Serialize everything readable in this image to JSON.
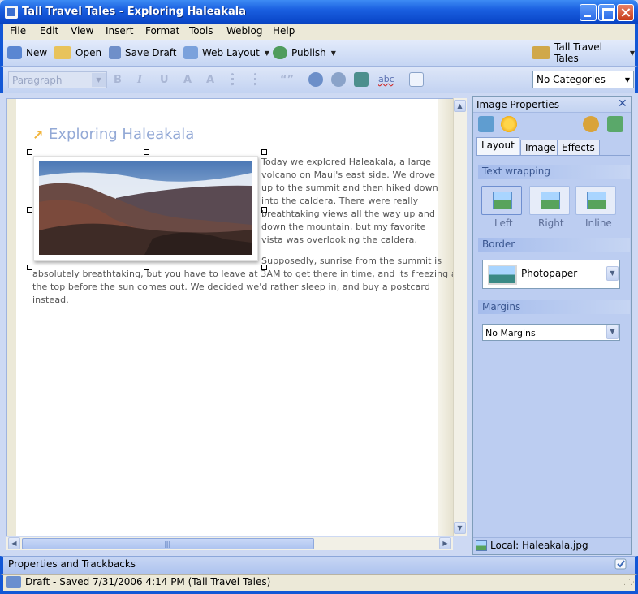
{
  "window": {
    "title": "Tall Travel Tales - Exploring Haleakala"
  },
  "menu": [
    "File",
    "Edit",
    "View",
    "Insert",
    "Format",
    "Tools",
    "Weblog",
    "Help"
  ],
  "toolbar": {
    "new_label": "New",
    "open_label": "Open",
    "save_draft_label": "Save Draft",
    "web_layout_label": "Web Layout",
    "publish_label": "Publish",
    "blog_label": "Tall Travel Tales"
  },
  "format_bar": {
    "style_value": "Paragraph",
    "bold": "B",
    "italic": "I",
    "underline": "U",
    "strike": "A",
    "color": "A",
    "quote": "“”",
    "spell": "abc",
    "category_value": "No Categories"
  },
  "editor": {
    "post_title": "Exploring Haleakala",
    "body_lines_beside_image": [
      "Today we explored Haleakala, a large",
      "volcano on Maui's east side.  We drove",
      "up to the summit and then hiked down",
      "into the caldera.  There were really",
      "breathtaking views all the way up and",
      "down the mountain, but my favorite",
      "vista was overlooking the caldera."
    ],
    "body_lines_full": [
      "Supposedly, sunrise from the summit is",
      "absolutely breathtaking, but you have to leave at 3AM to get there in time, and its freezing at",
      "the top before the sun comes out. We decided we'd rather sleep in, and buy a postcard",
      "instead."
    ]
  },
  "image_properties": {
    "title": "Image Properties",
    "tabs": [
      "Layout",
      "Image",
      "Effects"
    ],
    "active_tab": "Layout",
    "text_wrapping_label": "Text wrapping",
    "wrap_options": [
      "Left",
      "Right",
      "Inline"
    ],
    "selected_wrap": "Left",
    "border_label": "Border",
    "border_value": "Photopaper",
    "margins_label": "Margins",
    "margins_value": "No Margins",
    "local_file": "Local:  Haleakala.jpg"
  },
  "bottom": {
    "properties_label": "Properties and Trackbacks",
    "status_text": "Draft - Saved 7/31/2006 4:14 PM (Tall Travel Tales)"
  },
  "colors": {
    "title_bar": "#1a5fe0",
    "panel_bg": "#bccdf1",
    "post_title": "#93a9d6",
    "body_text": "#555555"
  }
}
